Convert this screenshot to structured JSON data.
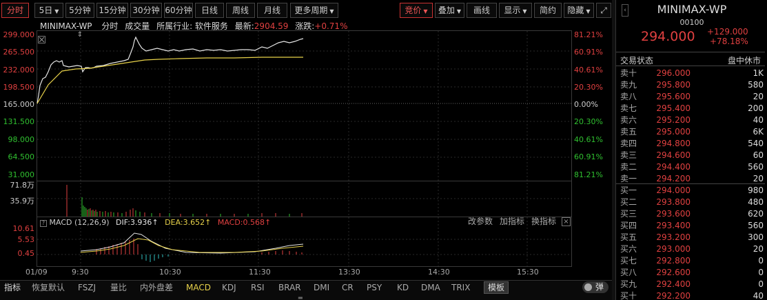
{
  "toolbar": {
    "items": [
      "分时",
      "5日",
      "5分钟",
      "15分钟",
      "30分钟",
      "60分钟",
      "日线",
      "周线",
      "月线",
      "更多周期"
    ],
    "right": [
      "竞价",
      "叠加",
      "画线",
      "显示",
      "简约",
      "隐藏"
    ]
  },
  "header": {
    "name": "MINIMAX-WP",
    "time": "分时",
    "vol": "成交量",
    "industry": "所属行业: 软件服务",
    "latest_label": "最新:",
    "latest": "2904.59",
    "change_label": "涨跌:",
    "change": "+0.71%"
  },
  "left_axis": [
    "299.000",
    "265.500",
    "232.000",
    "198.500",
    "165.000",
    "131.500",
    "98.000",
    "64.500",
    "31.000"
  ],
  "right_axis": [
    "81.21%",
    "60.91%",
    "40.61%",
    "20.30%",
    "0.00%",
    "20.30%",
    "40.61%",
    "60.91%",
    "81.21%"
  ],
  "vol_axis": [
    "71.8万",
    "35.9万"
  ],
  "macd": {
    "title": "MACD (12,26,9)",
    "dif": "DIF:3.936",
    "dea": "DEA:3.652",
    "macd": "MACD:0.568",
    "axis": [
      "10.61",
      "5.53",
      "0.45"
    ],
    "tools": [
      "改参数",
      "加指标",
      "换指标"
    ]
  },
  "time_axis": [
    "01/09",
    "9:30",
    "10:30",
    "11:30",
    "13:30",
    "14:30",
    "15:30"
  ],
  "bottom": {
    "items": [
      "指标",
      "恢复默认",
      "FSZJ",
      "量比",
      "内外盘差",
      "MACD",
      "KDJ",
      "RSI",
      "BRAR",
      "DMI",
      "CR",
      "PSY",
      "KD",
      "DMA",
      "TRIX",
      "模板"
    ],
    "active": "MACD",
    "toggle": "弹"
  },
  "quote": {
    "name": "MINIMAX-WP",
    "code": "00100",
    "price": "294.000",
    "change": "+129.000",
    "pct": "+78.18%",
    "status_label": "交易状态",
    "status": "盘中休市"
  },
  "asks": [
    [
      "卖十",
      "296.000",
      "1K"
    ],
    [
      "卖九",
      "295.800",
      "580"
    ],
    [
      "卖八",
      "295.600",
      "20"
    ],
    [
      "卖七",
      "295.400",
      "200"
    ],
    [
      "卖六",
      "295.200",
      "40"
    ],
    [
      "卖五",
      "295.000",
      "6K"
    ],
    [
      "卖四",
      "294.800",
      "540"
    ],
    [
      "卖三",
      "294.600",
      "60"
    ],
    [
      "卖二",
      "294.400",
      "560"
    ],
    [
      "卖一",
      "294.200",
      "20"
    ]
  ],
  "bids": [
    [
      "买一",
      "294.000",
      "980"
    ],
    [
      "买二",
      "293.800",
      "480"
    ],
    [
      "买三",
      "293.600",
      "620"
    ],
    [
      "买四",
      "293.400",
      "560"
    ],
    [
      "买五",
      "293.200",
      "300"
    ],
    [
      "买六",
      "293.000",
      "20"
    ],
    [
      "买七",
      "292.800",
      "0"
    ],
    [
      "买八",
      "292.600",
      "0"
    ],
    [
      "买九",
      "292.400",
      "0"
    ],
    [
      "买十",
      "292.200",
      "40"
    ]
  ],
  "chart_data": {
    "type": "line",
    "series": [],
    "ylim": [
      31,
      299
    ],
    "reference": 165,
    "x_range": [
      "9:30",
      "16:00"
    ]
  }
}
